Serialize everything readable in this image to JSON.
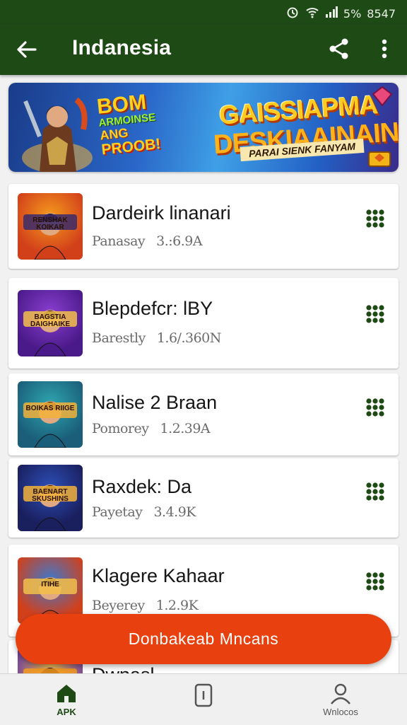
{
  "status_bar": {
    "battery": "5%",
    "time": "8547"
  },
  "app_bar": {
    "title": "Indanesia"
  },
  "banner": {
    "left_line1": "BOM",
    "left_line2": "ARMOINSE",
    "left_line3": "ANG",
    "left_line4": "PROOB!",
    "headline1": "GAISSIAPMA",
    "headline2": "DESKIAAINAIN",
    "ribbon": "PARAI SIENK FANYAM"
  },
  "apps": [
    {
      "name": "Dardeirk linanari",
      "category": "Panasay",
      "size": "3.:6.9A",
      "thumb_text": "RENSHAK KOIKAR",
      "palette": "orange"
    },
    {
      "name": "Blepdefcr: lBY",
      "category": "Barestly",
      "size": "1.6/.360N",
      "thumb_text": "BAGSTIA DAIGHAIKE",
      "palette": "purple"
    },
    {
      "name": "Nalise 2 Braan",
      "category": "Pomorey",
      "size": "1.2.39A",
      "thumb_text": "BOIKAS RIIGE",
      "palette": "teal"
    },
    {
      "name": "Raxdek: Da",
      "category": "Payetay",
      "size": "3.4.9K",
      "thumb_text": "BAENART SKUSHINS",
      "palette": "blue"
    },
    {
      "name": "Klagere Kahaar",
      "category": "Beyerey",
      "size": "1.2.9K",
      "thumb_text": "ITIHE",
      "palette": "hero"
    },
    {
      "name": "Dwpasl",
      "category": "",
      "size": "",
      "thumb_text": "",
      "palette": "yellow"
    }
  ],
  "fab": {
    "label": "Donbakeab Mncans"
  },
  "bottom_nav": [
    {
      "label": "APK",
      "icon": "home-icon"
    },
    {
      "label": "",
      "icon": "phone-icon"
    },
    {
      "label": "Wnlocos",
      "icon": "person-icon"
    }
  ],
  "colors": {
    "app_bar": "#1e4a16",
    "fab": "#e8400e",
    "accent_green": "#1e4a16"
  }
}
